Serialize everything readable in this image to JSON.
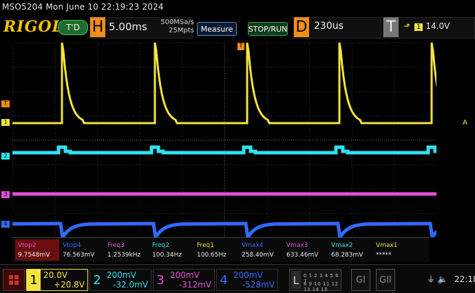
{
  "title_bar": "MSO5204  Mon June 10 22:19:23 2024",
  "toolbar": {
    "brand": "RIGOL",
    "trigger_mode": "T'D",
    "horizontal_letter": "H",
    "timebase": "5.00ms",
    "sample_rate": "500MSa/s",
    "memory_depth": "25Mpts",
    "measure_label": "Measure",
    "stop_run_label": "STOP/RUN",
    "delay_letter": "D",
    "delay_value": "230us",
    "trigger_letter": "T",
    "trigger_edge": "⬏",
    "trigger_source": "1",
    "trigger_level": "14.0V"
  },
  "markers": {
    "trigger_top": "T",
    "left_t": "T",
    "ch1": "1",
    "ch2": "2",
    "ch3": "3",
    "ch4": "4",
    "right_a": "A"
  },
  "measurements": [
    {
      "label": "Vtop2",
      "value": "9.7548mV",
      "color": "#e94ddb",
      "highlight": true
    },
    {
      "label": "Vtop4",
      "value": "76.563mV",
      "color": "#2f6bff"
    },
    {
      "label": "Freq3",
      "value": "1.2539kHz",
      "color": "#e94ddb"
    },
    {
      "label": "Freq2",
      "value": "100.34Hz",
      "color": "#2ee2f0"
    },
    {
      "label": "Freq1",
      "value": "100.65Hz",
      "color": "#f3e43f"
    },
    {
      "label": "Vmax4",
      "value": "258.40mV",
      "color": "#2f6bff"
    },
    {
      "label": "Vmax3",
      "value": "633.46mV",
      "color": "#e94ddb"
    },
    {
      "label": "Vmax2",
      "value": "68.283mV",
      "color": "#2ee2f0"
    },
    {
      "label": "Vmax1",
      "value": "*****",
      "color": "#f3e43f"
    }
  ],
  "channels": [
    {
      "num": "1",
      "scale": "20.0V",
      "offset": "+20.8V",
      "color": "#f3e43f"
    },
    {
      "num": "2",
      "scale": "200mV",
      "offset": "-32.0mV",
      "color": "#2ee2f0"
    },
    {
      "num": "3",
      "scale": "200mV",
      "offset": "-312mV",
      "color": "#e94ddb"
    },
    {
      "num": "4",
      "scale": "200mV",
      "offset": "-528mV",
      "color": "#2f6bff"
    }
  ],
  "logic": {
    "letter": "L",
    "row1": "0 1 2 3 4 5 6 7",
    "row2": "8 9 10 11 12 13 14 15"
  },
  "gen1": "GI",
  "gen2": "GII",
  "clock": "22:18",
  "colors": {
    "ch1": "#f3e43f",
    "ch2": "#2ee2f0",
    "ch3": "#e94ddb",
    "ch4": "#2f6bff",
    "accent": "#f08d1b"
  }
}
